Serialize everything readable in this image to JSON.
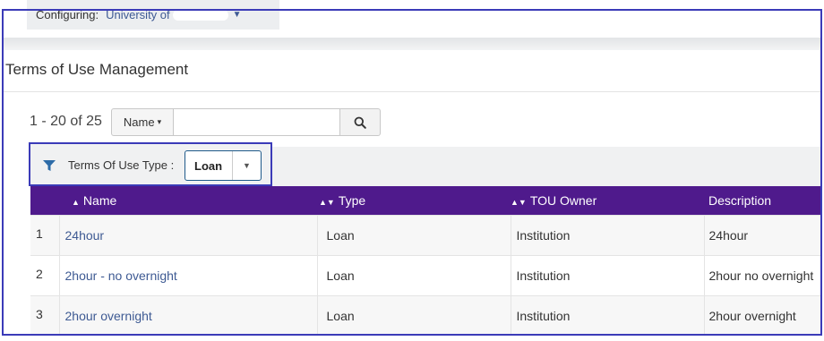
{
  "config": {
    "label": "Configuring:",
    "value": "University of ",
    "value_tail": "",
    "caret": "▼"
  },
  "page": {
    "title": "Terms of Use Management"
  },
  "pager": {
    "range": "1 - 20 of 25"
  },
  "search": {
    "field_label": "Name",
    "field_caret": "▾",
    "placeholder": "",
    "button_icon": "search-icon"
  },
  "filter": {
    "label": "Terms Of Use Type :",
    "value": "Loan",
    "caret": "▼",
    "icon": "funnel-icon"
  },
  "table": {
    "columns": [
      {
        "label": "Name",
        "sort": "▲"
      },
      {
        "label": "Type",
        "sort": "▲▼"
      },
      {
        "label": "TOU Owner",
        "sort": "▲▼"
      },
      {
        "label": "Description",
        "sort": ""
      }
    ],
    "rows": [
      {
        "num": "1",
        "name": "24hour",
        "type": "Loan",
        "owner": "Institution",
        "description": "24hour"
      },
      {
        "num": "2",
        "name": "2hour - no overnight",
        "type": "Loan",
        "owner": "Institution",
        "description": "2hour no overnight"
      },
      {
        "num": "3",
        "name": "2hour overnight",
        "type": "Loan",
        "owner": "Institution",
        "description": "2hour overnight"
      }
    ]
  },
  "colors": {
    "header_bg": "#4f1a8c",
    "link": "#3e5a93",
    "highlight_frame": "#3b3bb8",
    "filter_icon": "#2d6ca8"
  }
}
